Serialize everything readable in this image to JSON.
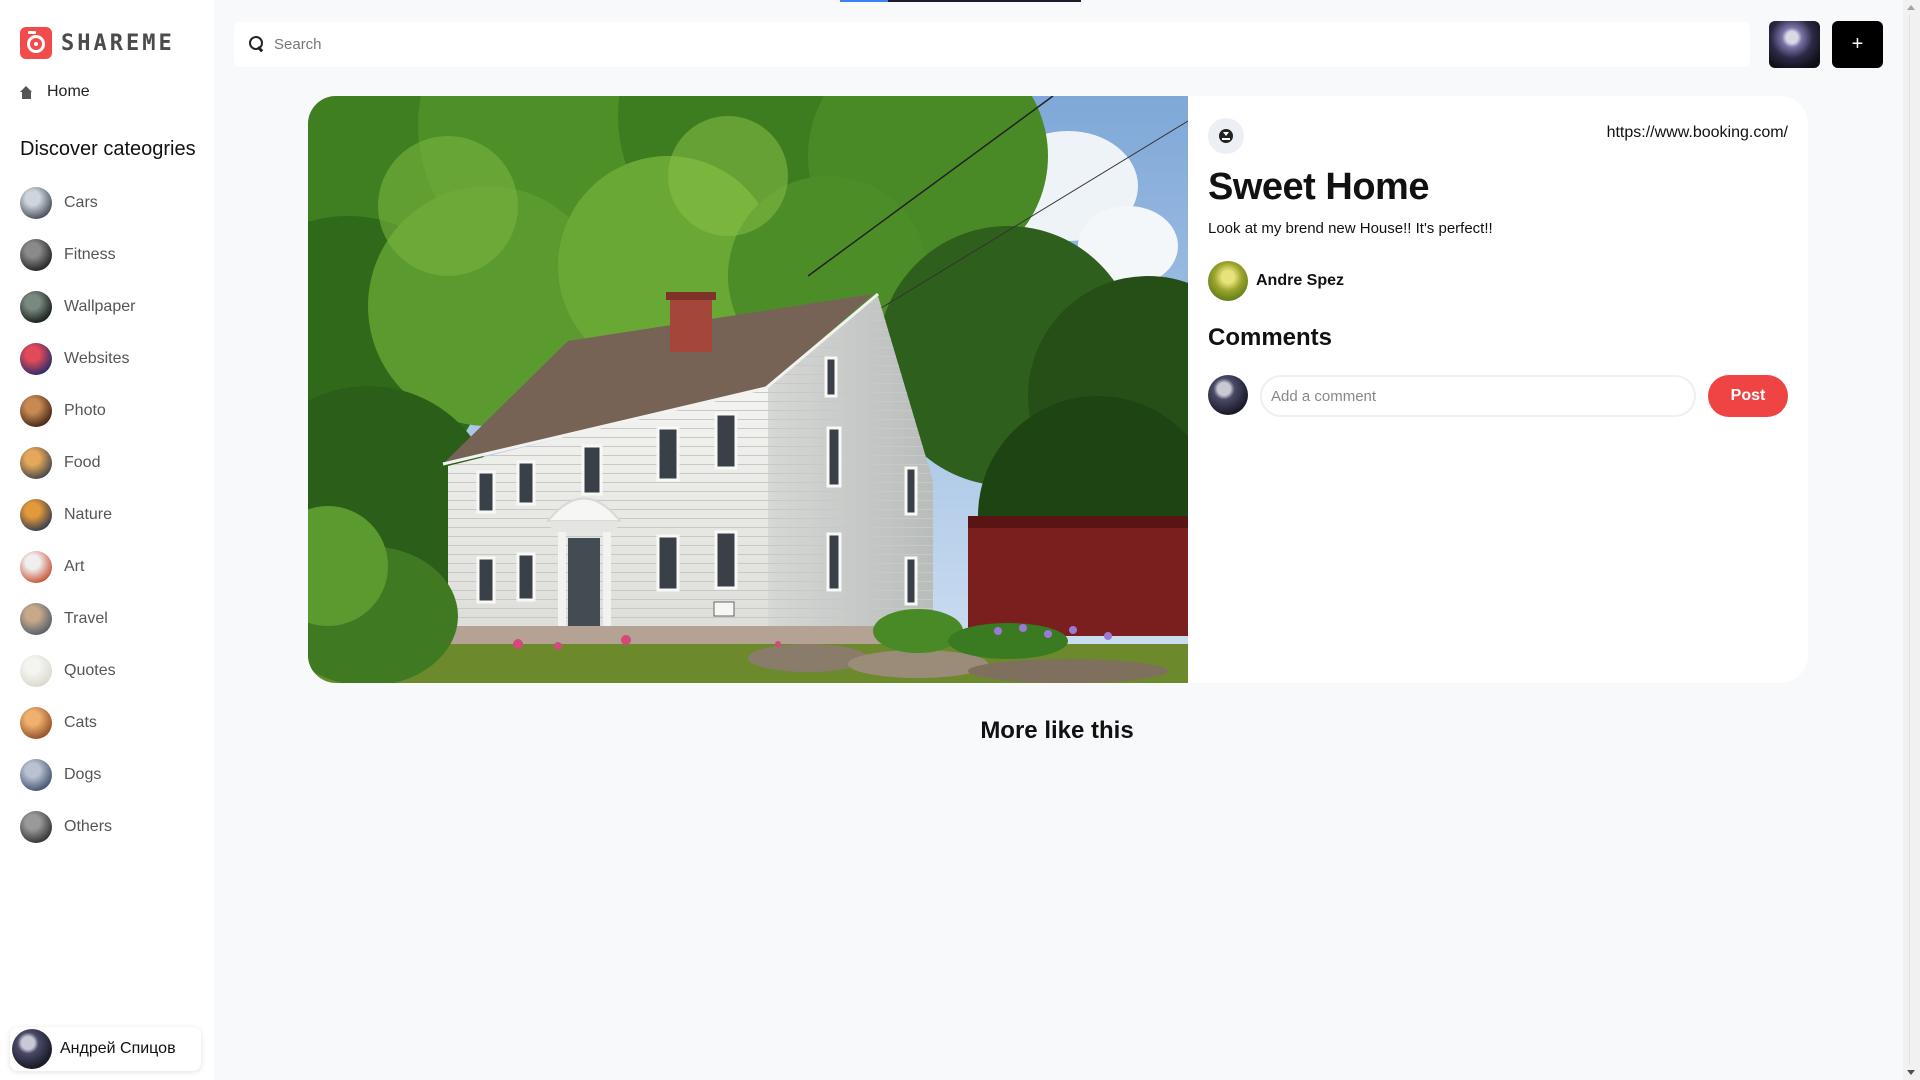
{
  "app": {
    "brand": "SHAREME",
    "accent_color": "#f14b4b"
  },
  "sidebar": {
    "home_label": "Home",
    "discover_title": "Discover cateogries",
    "categories": [
      {
        "label": "Cars",
        "icon": "cars-category-image",
        "colors": [
          "#cfd5dc",
          "#3b4350"
        ]
      },
      {
        "label": "Fitness",
        "icon": "fitness-category-image",
        "colors": [
          "#8a8a8a",
          "#1b1b1b"
        ]
      },
      {
        "label": "Wallpaper",
        "icon": "wallpaper-category-image",
        "colors": [
          "#7a8a80",
          "#0e1512"
        ]
      },
      {
        "label": "Websites",
        "icon": "websites-category-image",
        "colors": [
          "#e24a5a",
          "#1c2a6a"
        ]
      },
      {
        "label": "Photo",
        "icon": "photo-category-image",
        "colors": [
          "#c68a52",
          "#3a1e12"
        ]
      },
      {
        "label": "Food",
        "icon": "food-category-image",
        "colors": [
          "#e5a85a",
          "#3a3f4a"
        ]
      },
      {
        "label": "Nature",
        "icon": "nature-category-image",
        "colors": [
          "#e49a3a",
          "#2a3550"
        ]
      },
      {
        "label": "Art",
        "icon": "art-category-image",
        "colors": [
          "#f0eeee",
          "#c44a2a"
        ]
      },
      {
        "label": "Travel",
        "icon": "travel-category-image",
        "colors": [
          "#c7a88a",
          "#4a5a6a"
        ]
      },
      {
        "label": "Quotes",
        "icon": "quotes-category-image",
        "colors": [
          "#f4f4f0",
          "#d8d8cc"
        ]
      },
      {
        "label": "Cats",
        "icon": "cats-category-image",
        "colors": [
          "#f0b070",
          "#8a4a20"
        ]
      },
      {
        "label": "Dogs",
        "icon": "dogs-category-image",
        "colors": [
          "#b8c2d0",
          "#3a4a6a"
        ]
      },
      {
        "label": "Others",
        "icon": "others-category-image",
        "colors": [
          "#9a9a9a",
          "#2a2a2a"
        ]
      }
    ],
    "user_name": "Андрей Спицов"
  },
  "header": {
    "search_placeholder": "Search",
    "search_value": "",
    "add_button_label": "+"
  },
  "pin": {
    "source_url": "https://www.booking.com/",
    "title": "Sweet Home",
    "description": "Look at my brend new House!! It's perfect!!",
    "author_name": "Andre Spez",
    "comments_title": "Comments",
    "comment_placeholder": "Add a comment",
    "comment_value": "",
    "post_button_label": "Post"
  },
  "more": {
    "title": "More like this"
  }
}
